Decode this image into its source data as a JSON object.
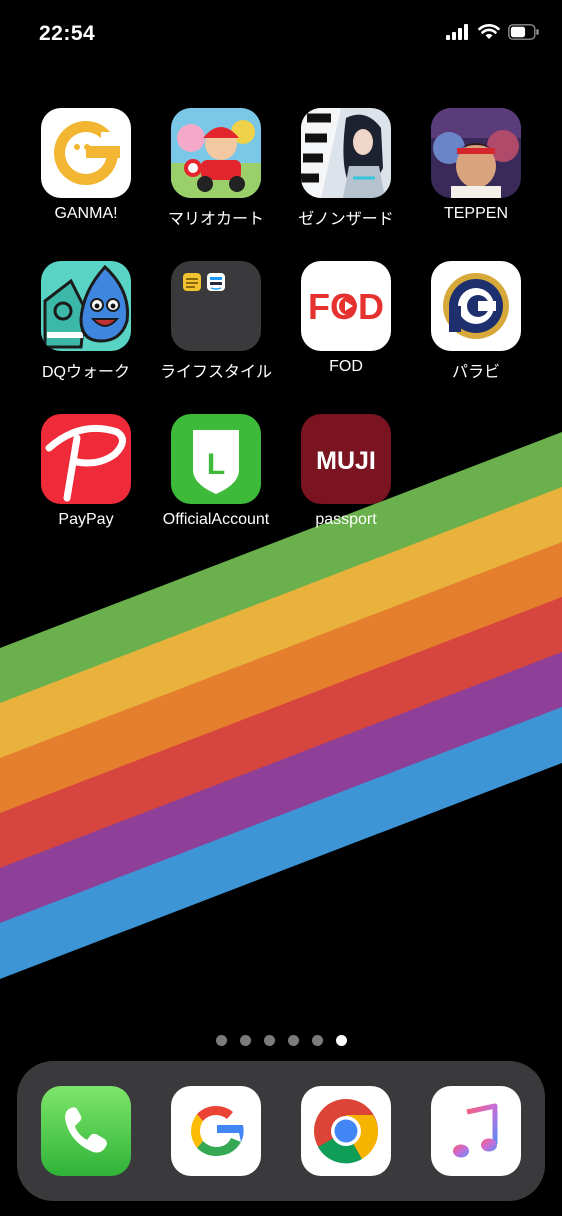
{
  "status_bar": {
    "time": "22:54",
    "signal_icon": "cellular-signal-icon",
    "wifi_icon": "wifi-icon",
    "battery_icon": "battery-icon",
    "battery_level": 0.65
  },
  "wallpaper": {
    "stripe_colors": [
      "#6ab04c",
      "#e8b23c",
      "#e57f2e",
      "#d6463e",
      "#8e3f98",
      "#3d95d6"
    ]
  },
  "home_apps": [
    {
      "label": "GANMA!",
      "icon": "ganma-app-icon"
    },
    {
      "label": "マリオカート",
      "icon": "mario-kart-app-icon"
    },
    {
      "label": "ゼノンザード",
      "icon": "zenonzard-app-icon"
    },
    {
      "label": "TEPPEN",
      "icon": "teppen-app-icon"
    },
    {
      "label": "DQウォーク",
      "icon": "dq-walk-app-icon"
    },
    {
      "label": "ライフスタイル",
      "icon": "lifestyle-folder-icon"
    },
    {
      "label": "FOD",
      "icon": "fod-app-icon",
      "icon_text": "FOD"
    },
    {
      "label": "パラビ",
      "icon": "paravi-app-icon"
    },
    {
      "label": "PayPay",
      "icon": "paypay-app-icon"
    },
    {
      "label": "OfficialAccount",
      "icon": "line-official-account-app-icon",
      "icon_text": "L"
    },
    {
      "label": "passport",
      "icon": "muji-passport-app-icon",
      "icon_text": "MUJI"
    }
  ],
  "folder_mini_apps": [
    "mini-app-icon-yellow",
    "mini-app-icon-prime-video"
  ],
  "page_indicator": {
    "total": 6,
    "current": 6
  },
  "dock": [
    {
      "icon": "phone-app-icon"
    },
    {
      "icon": "google-app-icon"
    },
    {
      "icon": "chrome-app-icon"
    },
    {
      "icon": "music-app-icon"
    }
  ]
}
